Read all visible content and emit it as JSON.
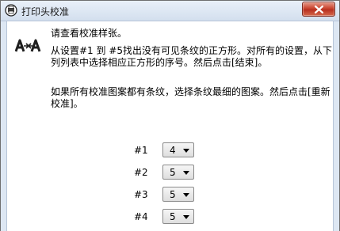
{
  "window": {
    "title": "打印头校准",
    "icon": "printer-icon",
    "close_icon": "close-icon"
  },
  "content": {
    "instruction_1": "请查看校准样张。",
    "instruction_2": "从设置#1 到 #5找出没有可见条纹的正方形。对所有的设置，从下列列表中选择相应正方形的序号。然后点击[结束]。",
    "instruction_3": "如果所有校准图案都有条纹，选择条纹最细的图案。然后点击[重新校准]。"
  },
  "settings": [
    {
      "label": "#1",
      "value": "4"
    },
    {
      "label": "#2",
      "value": "5"
    },
    {
      "label": "#3",
      "value": "5"
    },
    {
      "label": "#4",
      "value": "5"
    }
  ]
}
